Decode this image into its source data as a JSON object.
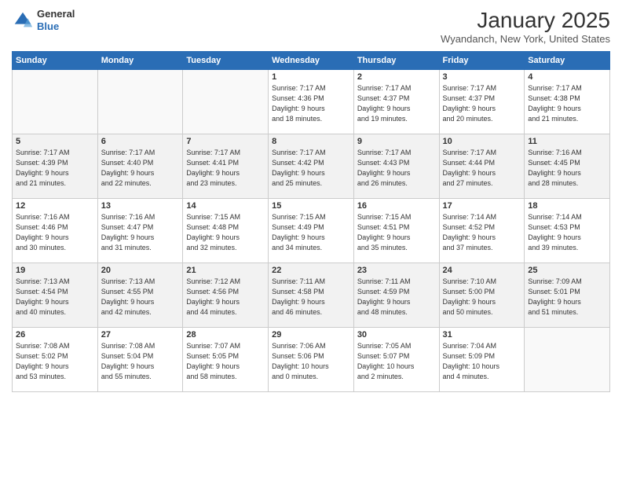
{
  "header": {
    "logo_line1": "General",
    "logo_line2": "Blue",
    "month": "January 2025",
    "location": "Wyandanch, New York, United States"
  },
  "days_of_week": [
    "Sunday",
    "Monday",
    "Tuesday",
    "Wednesday",
    "Thursday",
    "Friday",
    "Saturday"
  ],
  "weeks": [
    [
      {
        "day": "",
        "info": ""
      },
      {
        "day": "",
        "info": ""
      },
      {
        "day": "",
        "info": ""
      },
      {
        "day": "1",
        "info": "Sunrise: 7:17 AM\nSunset: 4:36 PM\nDaylight: 9 hours\nand 18 minutes."
      },
      {
        "day": "2",
        "info": "Sunrise: 7:17 AM\nSunset: 4:37 PM\nDaylight: 9 hours\nand 19 minutes."
      },
      {
        "day": "3",
        "info": "Sunrise: 7:17 AM\nSunset: 4:37 PM\nDaylight: 9 hours\nand 20 minutes."
      },
      {
        "day": "4",
        "info": "Sunrise: 7:17 AM\nSunset: 4:38 PM\nDaylight: 9 hours\nand 21 minutes."
      }
    ],
    [
      {
        "day": "5",
        "info": "Sunrise: 7:17 AM\nSunset: 4:39 PM\nDaylight: 9 hours\nand 21 minutes."
      },
      {
        "day": "6",
        "info": "Sunrise: 7:17 AM\nSunset: 4:40 PM\nDaylight: 9 hours\nand 22 minutes."
      },
      {
        "day": "7",
        "info": "Sunrise: 7:17 AM\nSunset: 4:41 PM\nDaylight: 9 hours\nand 23 minutes."
      },
      {
        "day": "8",
        "info": "Sunrise: 7:17 AM\nSunset: 4:42 PM\nDaylight: 9 hours\nand 25 minutes."
      },
      {
        "day": "9",
        "info": "Sunrise: 7:17 AM\nSunset: 4:43 PM\nDaylight: 9 hours\nand 26 minutes."
      },
      {
        "day": "10",
        "info": "Sunrise: 7:17 AM\nSunset: 4:44 PM\nDaylight: 9 hours\nand 27 minutes."
      },
      {
        "day": "11",
        "info": "Sunrise: 7:16 AM\nSunset: 4:45 PM\nDaylight: 9 hours\nand 28 minutes."
      }
    ],
    [
      {
        "day": "12",
        "info": "Sunrise: 7:16 AM\nSunset: 4:46 PM\nDaylight: 9 hours\nand 30 minutes."
      },
      {
        "day": "13",
        "info": "Sunrise: 7:16 AM\nSunset: 4:47 PM\nDaylight: 9 hours\nand 31 minutes."
      },
      {
        "day": "14",
        "info": "Sunrise: 7:15 AM\nSunset: 4:48 PM\nDaylight: 9 hours\nand 32 minutes."
      },
      {
        "day": "15",
        "info": "Sunrise: 7:15 AM\nSunset: 4:49 PM\nDaylight: 9 hours\nand 34 minutes."
      },
      {
        "day": "16",
        "info": "Sunrise: 7:15 AM\nSunset: 4:51 PM\nDaylight: 9 hours\nand 35 minutes."
      },
      {
        "day": "17",
        "info": "Sunrise: 7:14 AM\nSunset: 4:52 PM\nDaylight: 9 hours\nand 37 minutes."
      },
      {
        "day": "18",
        "info": "Sunrise: 7:14 AM\nSunset: 4:53 PM\nDaylight: 9 hours\nand 39 minutes."
      }
    ],
    [
      {
        "day": "19",
        "info": "Sunrise: 7:13 AM\nSunset: 4:54 PM\nDaylight: 9 hours\nand 40 minutes."
      },
      {
        "day": "20",
        "info": "Sunrise: 7:13 AM\nSunset: 4:55 PM\nDaylight: 9 hours\nand 42 minutes."
      },
      {
        "day": "21",
        "info": "Sunrise: 7:12 AM\nSunset: 4:56 PM\nDaylight: 9 hours\nand 44 minutes."
      },
      {
        "day": "22",
        "info": "Sunrise: 7:11 AM\nSunset: 4:58 PM\nDaylight: 9 hours\nand 46 minutes."
      },
      {
        "day": "23",
        "info": "Sunrise: 7:11 AM\nSunset: 4:59 PM\nDaylight: 9 hours\nand 48 minutes."
      },
      {
        "day": "24",
        "info": "Sunrise: 7:10 AM\nSunset: 5:00 PM\nDaylight: 9 hours\nand 50 minutes."
      },
      {
        "day": "25",
        "info": "Sunrise: 7:09 AM\nSunset: 5:01 PM\nDaylight: 9 hours\nand 51 minutes."
      }
    ],
    [
      {
        "day": "26",
        "info": "Sunrise: 7:08 AM\nSunset: 5:02 PM\nDaylight: 9 hours\nand 53 minutes."
      },
      {
        "day": "27",
        "info": "Sunrise: 7:08 AM\nSunset: 5:04 PM\nDaylight: 9 hours\nand 55 minutes."
      },
      {
        "day": "28",
        "info": "Sunrise: 7:07 AM\nSunset: 5:05 PM\nDaylight: 9 hours\nand 58 minutes."
      },
      {
        "day": "29",
        "info": "Sunrise: 7:06 AM\nSunset: 5:06 PM\nDaylight: 10 hours\nand 0 minutes."
      },
      {
        "day": "30",
        "info": "Sunrise: 7:05 AM\nSunset: 5:07 PM\nDaylight: 10 hours\nand 2 minutes."
      },
      {
        "day": "31",
        "info": "Sunrise: 7:04 AM\nSunset: 5:09 PM\nDaylight: 10 hours\nand 4 minutes."
      },
      {
        "day": "",
        "info": ""
      }
    ]
  ]
}
